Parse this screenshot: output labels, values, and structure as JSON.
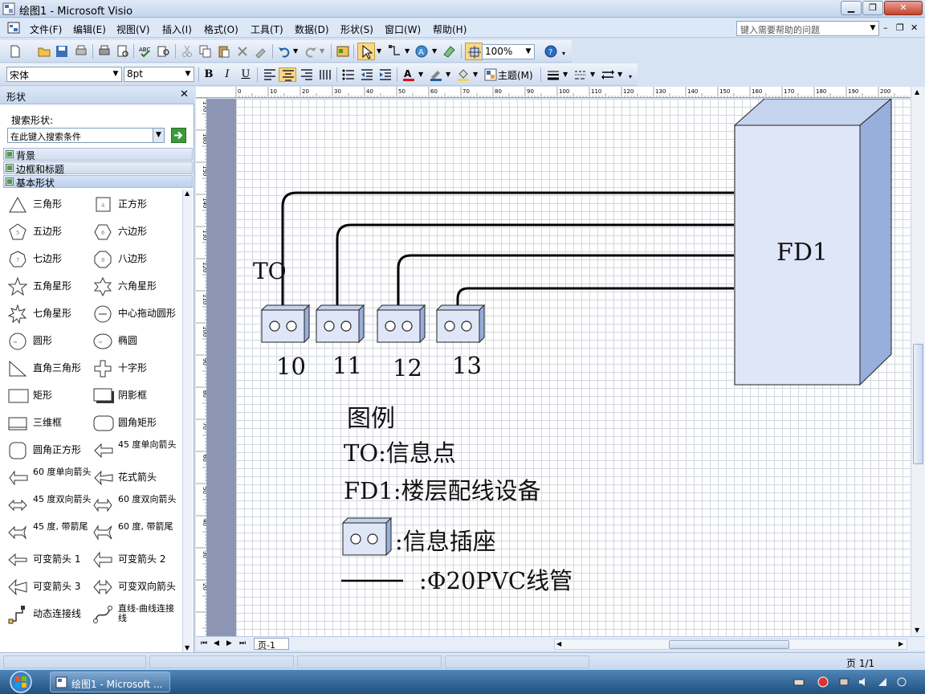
{
  "window": {
    "title": "绘图1 - Microsoft Visio"
  },
  "menu": {
    "items": [
      "文件(F)",
      "编辑(E)",
      "视图(V)",
      "插入(I)",
      "格式(O)",
      "工具(T)",
      "数据(D)",
      "形状(S)",
      "窗口(W)",
      "帮助(H)"
    ],
    "help_placeholder": "键入需要帮助的问题"
  },
  "toolbar": {
    "zoom": "100%",
    "font": "宋体",
    "font_size": "8pt",
    "theme_label": "主题(M)"
  },
  "shapes_panel": {
    "title": "形状",
    "search_label": "搜索形状:",
    "search_placeholder": "在此键入搜索条件",
    "stencils": [
      "背景",
      "边框和标题",
      "基本形状"
    ],
    "shapes": [
      [
        "三角形",
        "正方形"
      ],
      [
        "五边形",
        "六边形"
      ],
      [
        "七边形",
        "八边形"
      ],
      [
        "五角星形",
        "六角星形"
      ],
      [
        "七角星形",
        "中心拖动圆形"
      ],
      [
        "圆形",
        "椭圆"
      ],
      [
        "直角三角形",
        "十字形"
      ],
      [
        "矩形",
        "阴影框"
      ],
      [
        "三维框",
        "圆角矩形"
      ],
      [
        "圆角正方形",
        "45 度单向箭头"
      ],
      [
        "60 度单向箭头",
        "花式箭头"
      ],
      [
        "45 度双向箭头",
        "60 度双向箭头"
      ],
      [
        "45 度, 带箭尾",
        "60 度, 带箭尾"
      ],
      [
        "可变箭头 1",
        "可变箭头 2"
      ],
      [
        "可变箭头 3",
        "可变双向箭头"
      ],
      [
        "动态连接线",
        "直线-曲线连接线"
      ]
    ]
  },
  "diagram": {
    "to_label": "TO",
    "fd_label": "FD1",
    "socket_numbers": [
      "10",
      "11",
      "12",
      "13"
    ],
    "legend": {
      "title": "图例",
      "to_desc": "TO:信息点",
      "fd_desc": "FD1:楼层配线设备",
      "socket_desc": ":信息插座",
      "pipe_desc": ":Φ20PVC线管"
    }
  },
  "ruler": {
    "top_ticks": [
      "0",
      "10",
      "20",
      "30",
      "40",
      "50",
      "60",
      "70",
      "80",
      "90",
      "100",
      "110",
      "120",
      "130",
      "140",
      "150",
      "160",
      "170",
      "180",
      "190",
      "200"
    ],
    "left_ticks": [
      "170",
      "160",
      "150",
      "140",
      "130",
      "120",
      "110",
      "100",
      "90",
      "80",
      "70",
      "60",
      "50",
      "40",
      "30",
      "20"
    ]
  },
  "tabs": {
    "page": "页-1"
  },
  "status": {
    "page": "页 1/1"
  },
  "taskbar": {
    "item": "绘图1 - Microsoft ..."
  }
}
